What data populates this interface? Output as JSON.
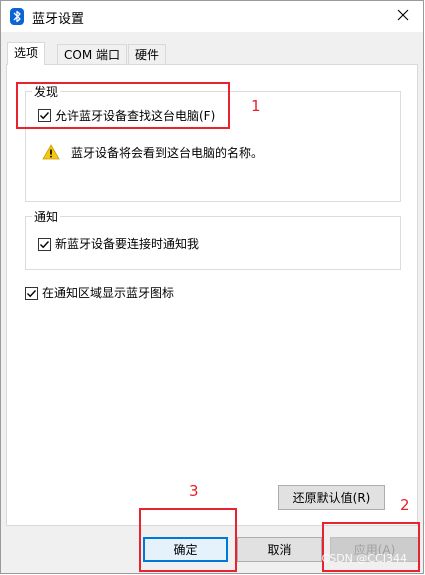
{
  "window": {
    "title": "蓝牙设置"
  },
  "tabs": [
    {
      "label": "选项",
      "active": true
    },
    {
      "label": "COM 端口",
      "active": false
    },
    {
      "label": "硬件",
      "active": false
    }
  ],
  "discovery": {
    "group_title": "发现",
    "allow_discovery_label": "允许蓝牙设备查找这台电脑(F)",
    "allow_discovery_checked": true,
    "warning_text": "蓝牙设备将会看到这台电脑的名称。"
  },
  "notifications": {
    "group_title": "通知",
    "notify_new_device_label": "新蓝牙设备要连接时通知我",
    "notify_new_device_checked": true
  },
  "tray": {
    "show_icon_label": "在通知区域显示蓝牙图标",
    "show_icon_checked": true
  },
  "buttons": {
    "restore_defaults": "还原默认值(R)",
    "ok": "确定",
    "cancel": "取消",
    "apply": "应用(A)"
  },
  "annotations": {
    "marker_1": "1",
    "marker_2": "2",
    "marker_3": "3",
    "color": "#e8222e"
  },
  "watermark": "CSDN @CCI344",
  "icons": {
    "title": "bluetooth-icon",
    "close": "close-icon",
    "warning": "warning-icon",
    "check": "checkmark-icon"
  }
}
